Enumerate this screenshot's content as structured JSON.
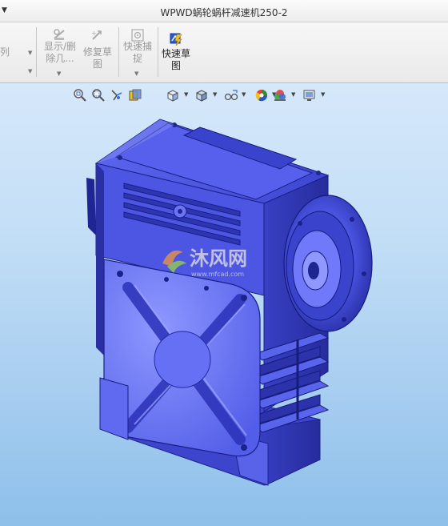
{
  "window": {
    "title": "WPWD蜗轮蜗杆减速机250-2"
  },
  "ribbon": {
    "partial_label": "列",
    "show_delete_geometry": {
      "line1": "显示/删",
      "line2": "除几..."
    },
    "repair_sketch": {
      "line1": "修复草",
      "line2": "图"
    },
    "quick_snap": {
      "line1": "快速捕",
      "line2": "捉"
    },
    "quick_sketch": {
      "line1": "快速草",
      "line2": "图"
    }
  },
  "view_toolbar": {
    "icons": [
      "zoom-to-fit-icon",
      "zoom-area-icon",
      "previous-view-icon",
      "section-view-icon",
      "view-orientation-icon",
      "display-style-icon",
      "hide-show-items-icon",
      "edit-appearance-icon",
      "apply-scene-icon",
      "view-settings-icon"
    ]
  },
  "watermark": {
    "main": "沐风网",
    "sub": "www.mfcad.com"
  },
  "colors": {
    "model_blue": "#4a55e0",
    "model_light": "#8a95ff",
    "model_dark": "#1c2290",
    "watermark_orange": "#f0983c",
    "watermark_green": "#9ad34a"
  }
}
